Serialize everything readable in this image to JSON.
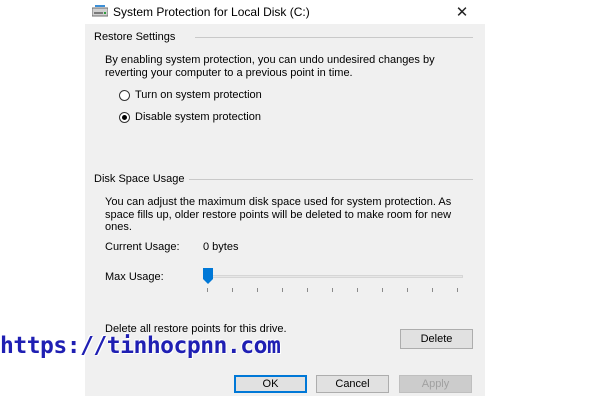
{
  "window": {
    "title": "System Protection for Local Disk (C:)",
    "close_glyph": "✕"
  },
  "restore_settings": {
    "group_label": "Restore Settings",
    "description": "By enabling system protection, you can undo undesired changes by reverting your computer to a previous point in time.",
    "options": [
      {
        "label": "Turn on system protection",
        "selected": false
      },
      {
        "label": "Disable system protection",
        "selected": true
      }
    ]
  },
  "disk_space": {
    "group_label": "Disk Space Usage",
    "description": "You can adjust the maximum disk space used for system protection. As space fills up, older restore points will be deleted to make room for new ones.",
    "current_usage_label": "Current Usage:",
    "current_usage_value": "0 bytes",
    "max_usage_label": "Max Usage:",
    "max_usage_fraction": 0,
    "delete_description": "Delete all restore points for this drive.",
    "delete_button": "Delete"
  },
  "buttons": {
    "ok": "OK",
    "cancel": "Cancel",
    "apply": "Apply"
  },
  "watermark": "https://tinhocpnn.com",
  "colors": {
    "dialog_bg": "#f0f0f0",
    "accent": "#0078d7",
    "watermark": "#1f1fb3"
  },
  "icons": {
    "title": "drive-icon",
    "close": "close-icon",
    "slider": "slider-thumb-icon"
  }
}
